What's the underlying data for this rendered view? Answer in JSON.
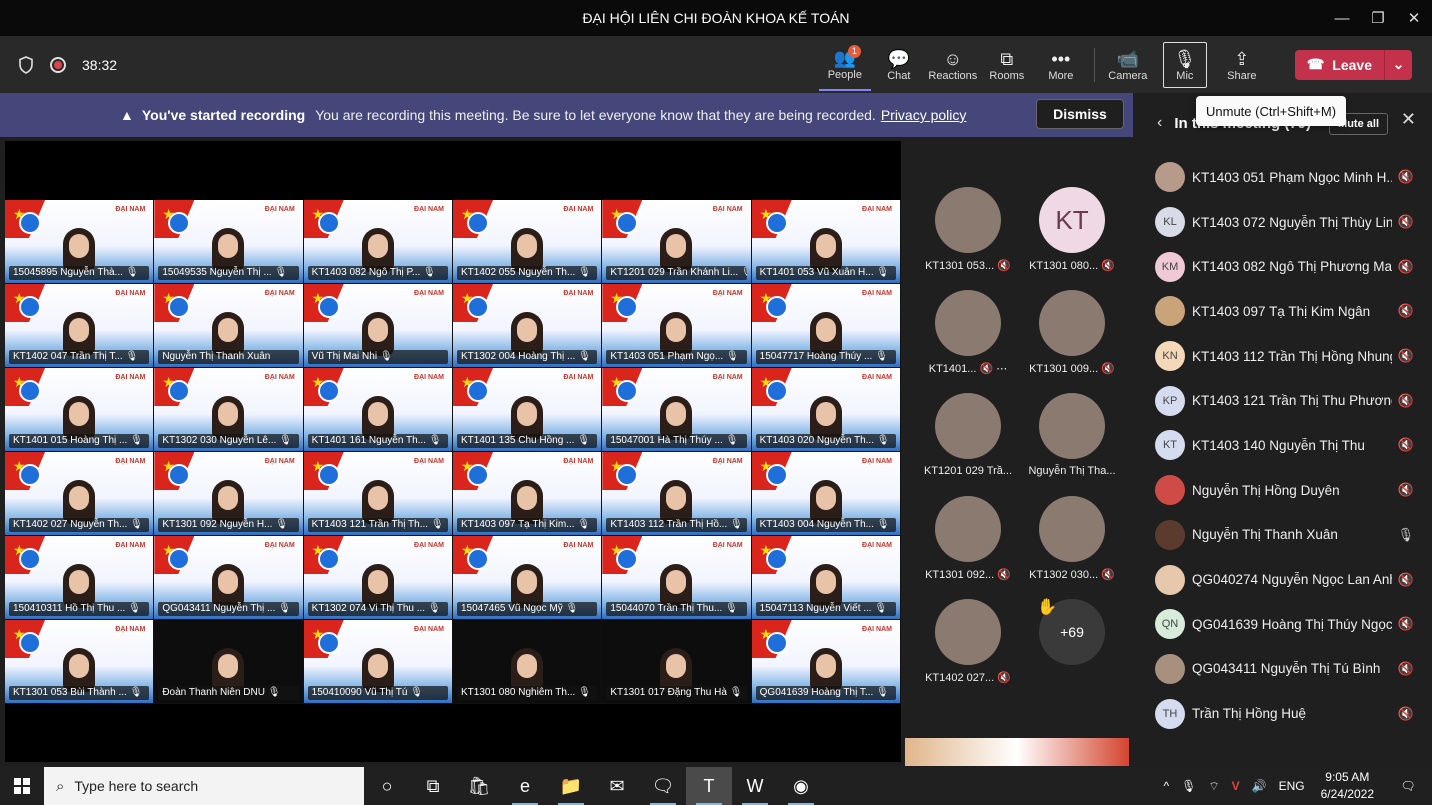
{
  "window": {
    "title": "ĐẠI HỘI LIÊN CHI ĐOÀN KHOA KẾ TOÁN",
    "minimize": "—",
    "restore": "❐",
    "close": "✕"
  },
  "toolbar": {
    "timer": "38:32",
    "people": {
      "label": "People",
      "badge": "1",
      "icon": "👥"
    },
    "chat": {
      "label": "Chat",
      "icon": "💬"
    },
    "reactions": {
      "label": "Reactions",
      "icon": "☺"
    },
    "rooms": {
      "label": "Rooms",
      "icon": "⧉"
    },
    "more": {
      "label": "More",
      "icon": "•••"
    },
    "camera": {
      "label": "Camera",
      "icon": "📹"
    },
    "mic": {
      "label": "Mic",
      "icon": "🎙"
    },
    "share": {
      "label": "Share",
      "icon": "⇪"
    },
    "leave": {
      "label": "Leave",
      "icon": "☎",
      "caret": "⌄"
    }
  },
  "tooltip": "Unmute (Ctrl+Shift+M)",
  "banner": {
    "icon": "▲",
    "title": "You've started recording",
    "message": "You are recording this meeting. Be sure to let everyone know that they are being recorded.",
    "link": "Privacy policy",
    "dismiss": "Dismiss"
  },
  "grid_tiles": [
    {
      "name": "15045895 Nguyễn Thà...",
      "dark": false,
      "mic": "🎙"
    },
    {
      "name": "15049535 Nguyễn Thị ...",
      "dark": false,
      "mic": "🎙"
    },
    {
      "name": "KT1403 082 Ngô Thị P...",
      "dark": false,
      "mic": "🎙"
    },
    {
      "name": "KT1402 055 Nguyễn Th...",
      "dark": false,
      "mic": "🎙"
    },
    {
      "name": "KT1201 029 Trần Khánh Li...",
      "dark": false,
      "mic": "🎙"
    },
    {
      "name": "KT1401 053 Vũ Xuân H...",
      "dark": false,
      "mic": "🎙"
    },
    {
      "name": "KT1402 047 Trần Thị T...",
      "dark": false,
      "mic": "🎙"
    },
    {
      "name": "Nguyễn Thị Thanh Xuân",
      "dark": false,
      "mic": ""
    },
    {
      "name": "Vũ Thị Mai Nhi",
      "dark": false,
      "mic": "🎙"
    },
    {
      "name": "KT1302 004 Hoàng Thị ...",
      "dark": false,
      "mic": "🎙"
    },
    {
      "name": "KT1403 051 Phạm Ngọ...",
      "dark": false,
      "mic": "🎙"
    },
    {
      "name": "15047717 Hoàng Thúy ...",
      "dark": false,
      "mic": "🎙"
    },
    {
      "name": "KT1401 015 Hoàng Thị ...",
      "dark": false,
      "mic": "🎙"
    },
    {
      "name": "KT1302 030 Nguyễn Lê...",
      "dark": false,
      "mic": "🎙"
    },
    {
      "name": "KT1401 161 Nguyễn Th...",
      "dark": false,
      "mic": "🎙"
    },
    {
      "name": "KT1401 135 Chu Hồng ...",
      "dark": false,
      "mic": "🎙"
    },
    {
      "name": "15047001 Hà Thị Thúy ...",
      "dark": false,
      "mic": "🎙"
    },
    {
      "name": "KT1403 020 Nguyễn Th...",
      "dark": false,
      "mic": "🎙"
    },
    {
      "name": "KT1402 027 Nguyễn Th...",
      "dark": false,
      "mic": "🎙"
    },
    {
      "name": "KT1301 092 Nguyễn H...",
      "dark": false,
      "mic": "🎙"
    },
    {
      "name": "KT1403 121 Trần Thị Th...",
      "dark": false,
      "mic": "🎙"
    },
    {
      "name": "KT1403 097 Tạ Thị Kim...",
      "dark": false,
      "mic": "🎙"
    },
    {
      "name": "KT1403 112 Trần Thị Hồ...",
      "dark": false,
      "mic": "🎙"
    },
    {
      "name": "KT1403 004 Nguyễn Th...",
      "dark": false,
      "mic": "🎙"
    },
    {
      "name": "150410311 Hồ Thị Thu ...",
      "dark": false,
      "mic": "🎙"
    },
    {
      "name": "QG043411 Nguyễn Thị ...",
      "dark": false,
      "mic": "🎙"
    },
    {
      "name": "KT1302 074 Vi Thị Thu ...",
      "dark": false,
      "mic": "🎙"
    },
    {
      "name": "15047465 Vũ Ngọc Mỹ",
      "dark": false,
      "mic": "🎙"
    },
    {
      "name": "15044070 Trần Thị Thu...",
      "dark": false,
      "mic": "🎙"
    },
    {
      "name": "15047113 Nguyễn Viết ...",
      "dark": false,
      "mic": "🎙"
    },
    {
      "name": "KT1301 053 Bùi Thành ...",
      "dark": false,
      "mic": "🎙"
    },
    {
      "name": "Đoàn Thanh Niên DNU",
      "dark": true,
      "mic": "🎙"
    },
    {
      "name": "150410090 Vũ Thị Tú",
      "dark": false,
      "mic": "🎙"
    },
    {
      "name": "KT1301 080 Nghiêm Th...",
      "dark": true,
      "mic": "🎙"
    },
    {
      "name": "KT1301 017 Đặng Thu Hà",
      "dark": true,
      "mic": "🎙"
    },
    {
      "name": "QG041639 Hoàng Thị T...",
      "dark": false,
      "mic": "🎙"
    }
  ],
  "side_participants": [
    {
      "label": "KT1301 053...",
      "initials": "",
      "mic": "🔇"
    },
    {
      "label": "KT1301 080...",
      "initials": "KT",
      "mic": "🔇"
    },
    {
      "label": "KT1401...",
      "initials": "",
      "mic": "🔇 ⋯"
    },
    {
      "label": "KT1301 009...",
      "initials": "",
      "mic": "🔇"
    },
    {
      "label": "KT1201 029 Trầ...",
      "initials": "",
      "mic": ""
    },
    {
      "label": "Nguyễn Thị Tha...",
      "initials": "",
      "mic": ""
    },
    {
      "label": "KT1301 092...",
      "initials": "",
      "mic": "🔇"
    },
    {
      "label": "KT1302 030...",
      "initials": "",
      "mic": "🔇"
    },
    {
      "label": "KT1402 027...",
      "initials": "",
      "mic": "🔇"
    },
    {
      "label": "",
      "initials": "+69",
      "mic": ""
    }
  ],
  "raised_hand": "✋",
  "panel": {
    "title": "In this meeting (79)",
    "back": "‹",
    "mute_all": "Mute all",
    "close": "✕",
    "people": [
      {
        "initials": "",
        "name": "KT1403 051 Phạm Ngọc Minh H...",
        "mic": "🔇",
        "color": "#b69a8a"
      },
      {
        "initials": "KL",
        "name": "KT1403 072 Nguyễn Thị Thùy Linh",
        "mic": "🔇",
        "color": "#d9dbe8"
      },
      {
        "initials": "KM",
        "name": "KT1403 082 Ngô Thị Phương Mai",
        "mic": "🔇",
        "color": "#f0c9d6"
      },
      {
        "initials": "",
        "name": "KT1403 097 Tạ Thị Kim Ngân",
        "mic": "🔇",
        "color": "#c9a37a"
      },
      {
        "initials": "KN",
        "name": "KT1403 112 Trần Thị Hồng Nhung",
        "mic": "🔇",
        "color": "#f4d8b8"
      },
      {
        "initials": "KP",
        "name": "KT1403 121 Trần Thị Thu Phương",
        "mic": "🔇",
        "color": "#d6dcef"
      },
      {
        "initials": "KT",
        "name": "KT1403 140 Nguyễn Thị Thu",
        "mic": "🔇",
        "color": "#d6dcef"
      },
      {
        "initials": "",
        "name": "Nguyễn Thị Hồng Duyên",
        "mic": "🔇",
        "color": "#cf4b45"
      },
      {
        "initials": "",
        "name": "Nguyễn Thị Thanh Xuân",
        "mic": "🎙",
        "color": "#5a3b2e"
      },
      {
        "initials": "",
        "name": "QG040274 Nguyễn Ngọc Lan Anh",
        "mic": "🔇",
        "color": "#e6c8ad"
      },
      {
        "initials": "QN",
        "name": "QG041639 Hoàng Thị Thúy Ngọc",
        "mic": "🔇",
        "color": "#d7ecd9"
      },
      {
        "initials": "",
        "name": "QG043411 Nguyễn Thị Tú Bình",
        "mic": "🔇",
        "color": "#a8907f"
      },
      {
        "initials": "TH",
        "name": "Trần Thị Hồng Huệ",
        "mic": "🔇",
        "color": "#d6dcef"
      }
    ]
  },
  "taskbar": {
    "search_placeholder": "Type here to search",
    "icons": [
      {
        "name": "cortana-icon",
        "glyph": "○"
      },
      {
        "name": "task-view-icon",
        "glyph": "⧉"
      },
      {
        "name": "store-icon",
        "glyph": "🛍"
      },
      {
        "name": "edge-icon",
        "glyph": "e"
      },
      {
        "name": "file-explorer-icon",
        "glyph": "📁"
      },
      {
        "name": "mail-icon",
        "glyph": "✉"
      },
      {
        "name": "chat-app-icon",
        "glyph": "🗨"
      },
      {
        "name": "teams-icon",
        "glyph": "T"
      },
      {
        "name": "word-icon",
        "glyph": "W"
      },
      {
        "name": "chrome-icon",
        "glyph": "◉"
      }
    ],
    "tray": {
      "chevron": "^",
      "mic": "🎙",
      "wifi": "⌔",
      "vivaldi": "V",
      "sound": "🔊",
      "lang": "ENG",
      "time": "9:05 AM",
      "date": "6/24/2022",
      "notif": "🗨"
    }
  }
}
